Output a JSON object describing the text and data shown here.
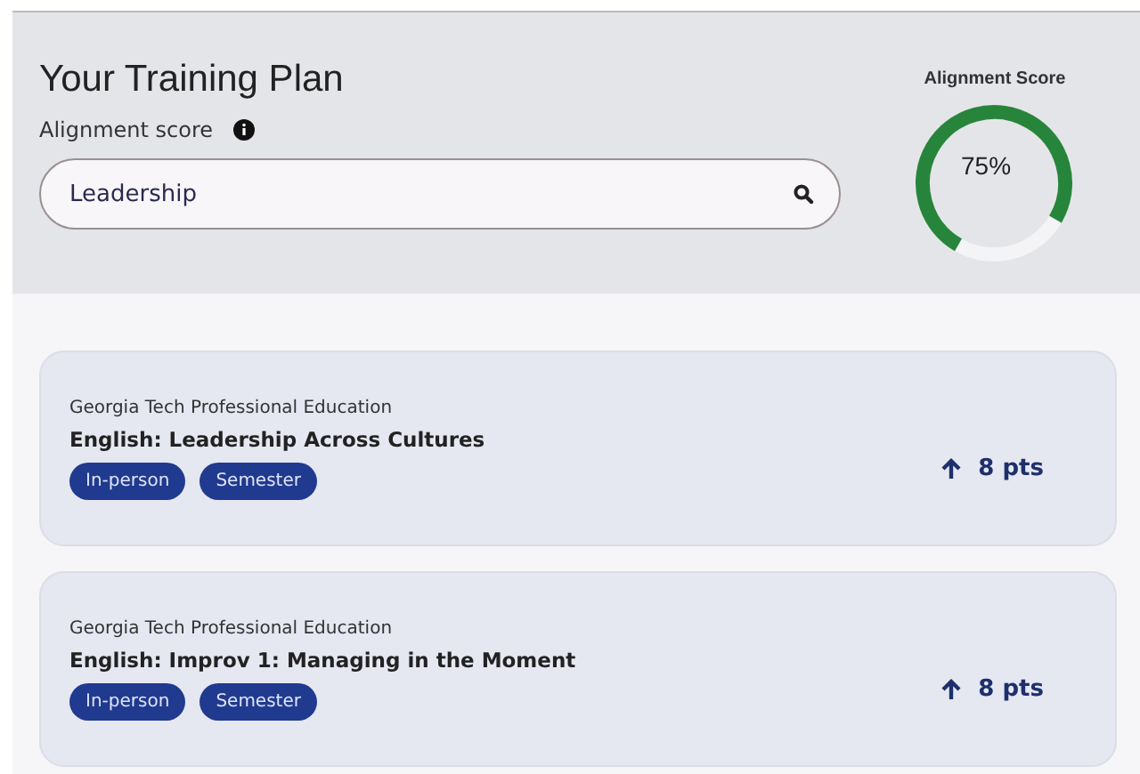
{
  "header": {
    "title": "Your Training Plan",
    "subtitle": "Alignment score",
    "search": {
      "value": "Leadership"
    },
    "score": {
      "label": "Alignment Score",
      "level": 0.75,
      "reading": "75%"
    }
  },
  "courses": [
    {
      "provider": "Georgia Tech Professional Education",
      "title": "English: Leadership Across Cultures",
      "tags": [
        "In-person",
        "Semester"
      ],
      "points": "8 pts"
    },
    {
      "provider": "Georgia Tech Professional Education",
      "title": "English: Improv 1: Managing in the Moment",
      "tags": [
        "In-person",
        "Semester"
      ],
      "points": "8 pts"
    }
  ]
}
